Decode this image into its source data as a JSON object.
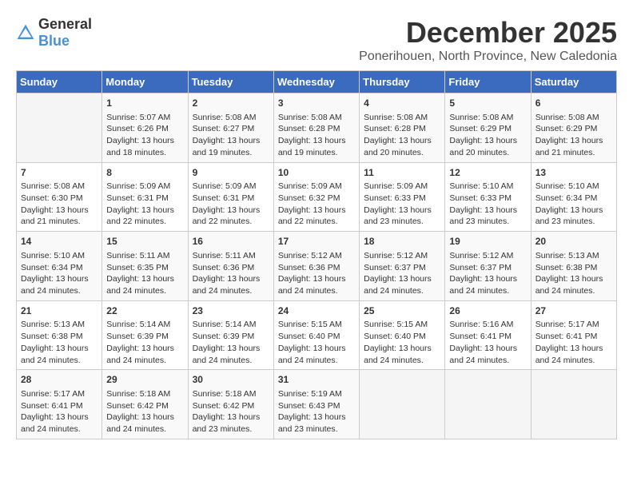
{
  "logo": {
    "general": "General",
    "blue": "Blue"
  },
  "title": "December 2025",
  "subtitle": "Ponerihouen, North Province, New Caledonia",
  "headers": [
    "Sunday",
    "Monday",
    "Tuesday",
    "Wednesday",
    "Thursday",
    "Friday",
    "Saturday"
  ],
  "weeks": [
    [
      {
        "day": "",
        "lines": []
      },
      {
        "day": "1",
        "lines": [
          "Sunrise: 5:07 AM",
          "Sunset: 6:26 PM",
          "Daylight: 13 hours",
          "and 18 minutes."
        ]
      },
      {
        "day": "2",
        "lines": [
          "Sunrise: 5:08 AM",
          "Sunset: 6:27 PM",
          "Daylight: 13 hours",
          "and 19 minutes."
        ]
      },
      {
        "day": "3",
        "lines": [
          "Sunrise: 5:08 AM",
          "Sunset: 6:28 PM",
          "Daylight: 13 hours",
          "and 19 minutes."
        ]
      },
      {
        "day": "4",
        "lines": [
          "Sunrise: 5:08 AM",
          "Sunset: 6:28 PM",
          "Daylight: 13 hours",
          "and 20 minutes."
        ]
      },
      {
        "day": "5",
        "lines": [
          "Sunrise: 5:08 AM",
          "Sunset: 6:29 PM",
          "Daylight: 13 hours",
          "and 20 minutes."
        ]
      },
      {
        "day": "6",
        "lines": [
          "Sunrise: 5:08 AM",
          "Sunset: 6:29 PM",
          "Daylight: 13 hours",
          "and 21 minutes."
        ]
      }
    ],
    [
      {
        "day": "7",
        "lines": [
          "Sunrise: 5:08 AM",
          "Sunset: 6:30 PM",
          "Daylight: 13 hours",
          "and 21 minutes."
        ]
      },
      {
        "day": "8",
        "lines": [
          "Sunrise: 5:09 AM",
          "Sunset: 6:31 PM",
          "Daylight: 13 hours",
          "and 22 minutes."
        ]
      },
      {
        "day": "9",
        "lines": [
          "Sunrise: 5:09 AM",
          "Sunset: 6:31 PM",
          "Daylight: 13 hours",
          "and 22 minutes."
        ]
      },
      {
        "day": "10",
        "lines": [
          "Sunrise: 5:09 AM",
          "Sunset: 6:32 PM",
          "Daylight: 13 hours",
          "and 22 minutes."
        ]
      },
      {
        "day": "11",
        "lines": [
          "Sunrise: 5:09 AM",
          "Sunset: 6:33 PM",
          "Daylight: 13 hours",
          "and 23 minutes."
        ]
      },
      {
        "day": "12",
        "lines": [
          "Sunrise: 5:10 AM",
          "Sunset: 6:33 PM",
          "Daylight: 13 hours",
          "and 23 minutes."
        ]
      },
      {
        "day": "13",
        "lines": [
          "Sunrise: 5:10 AM",
          "Sunset: 6:34 PM",
          "Daylight: 13 hours",
          "and 23 minutes."
        ]
      }
    ],
    [
      {
        "day": "14",
        "lines": [
          "Sunrise: 5:10 AM",
          "Sunset: 6:34 PM",
          "Daylight: 13 hours",
          "and 24 minutes."
        ]
      },
      {
        "day": "15",
        "lines": [
          "Sunrise: 5:11 AM",
          "Sunset: 6:35 PM",
          "Daylight: 13 hours",
          "and 24 minutes."
        ]
      },
      {
        "day": "16",
        "lines": [
          "Sunrise: 5:11 AM",
          "Sunset: 6:36 PM",
          "Daylight: 13 hours",
          "and 24 minutes."
        ]
      },
      {
        "day": "17",
        "lines": [
          "Sunrise: 5:12 AM",
          "Sunset: 6:36 PM",
          "Daylight: 13 hours",
          "and 24 minutes."
        ]
      },
      {
        "day": "18",
        "lines": [
          "Sunrise: 5:12 AM",
          "Sunset: 6:37 PM",
          "Daylight: 13 hours",
          "and 24 minutes."
        ]
      },
      {
        "day": "19",
        "lines": [
          "Sunrise: 5:12 AM",
          "Sunset: 6:37 PM",
          "Daylight: 13 hours",
          "and 24 minutes."
        ]
      },
      {
        "day": "20",
        "lines": [
          "Sunrise: 5:13 AM",
          "Sunset: 6:38 PM",
          "Daylight: 13 hours",
          "and 24 minutes."
        ]
      }
    ],
    [
      {
        "day": "21",
        "lines": [
          "Sunrise: 5:13 AM",
          "Sunset: 6:38 PM",
          "Daylight: 13 hours",
          "and 24 minutes."
        ]
      },
      {
        "day": "22",
        "lines": [
          "Sunrise: 5:14 AM",
          "Sunset: 6:39 PM",
          "Daylight: 13 hours",
          "and 24 minutes."
        ]
      },
      {
        "day": "23",
        "lines": [
          "Sunrise: 5:14 AM",
          "Sunset: 6:39 PM",
          "Daylight: 13 hours",
          "and 24 minutes."
        ]
      },
      {
        "day": "24",
        "lines": [
          "Sunrise: 5:15 AM",
          "Sunset: 6:40 PM",
          "Daylight: 13 hours",
          "and 24 minutes."
        ]
      },
      {
        "day": "25",
        "lines": [
          "Sunrise: 5:15 AM",
          "Sunset: 6:40 PM",
          "Daylight: 13 hours",
          "and 24 minutes."
        ]
      },
      {
        "day": "26",
        "lines": [
          "Sunrise: 5:16 AM",
          "Sunset: 6:41 PM",
          "Daylight: 13 hours",
          "and 24 minutes."
        ]
      },
      {
        "day": "27",
        "lines": [
          "Sunrise: 5:17 AM",
          "Sunset: 6:41 PM",
          "Daylight: 13 hours",
          "and 24 minutes."
        ]
      }
    ],
    [
      {
        "day": "28",
        "lines": [
          "Sunrise: 5:17 AM",
          "Sunset: 6:41 PM",
          "Daylight: 13 hours",
          "and 24 minutes."
        ]
      },
      {
        "day": "29",
        "lines": [
          "Sunrise: 5:18 AM",
          "Sunset: 6:42 PM",
          "Daylight: 13 hours",
          "and 24 minutes."
        ]
      },
      {
        "day": "30",
        "lines": [
          "Sunrise: 5:18 AM",
          "Sunset: 6:42 PM",
          "Daylight: 13 hours",
          "and 23 minutes."
        ]
      },
      {
        "day": "31",
        "lines": [
          "Sunrise: 5:19 AM",
          "Sunset: 6:43 PM",
          "Daylight: 13 hours",
          "and 23 minutes."
        ]
      },
      {
        "day": "",
        "lines": []
      },
      {
        "day": "",
        "lines": []
      },
      {
        "day": "",
        "lines": []
      }
    ]
  ]
}
